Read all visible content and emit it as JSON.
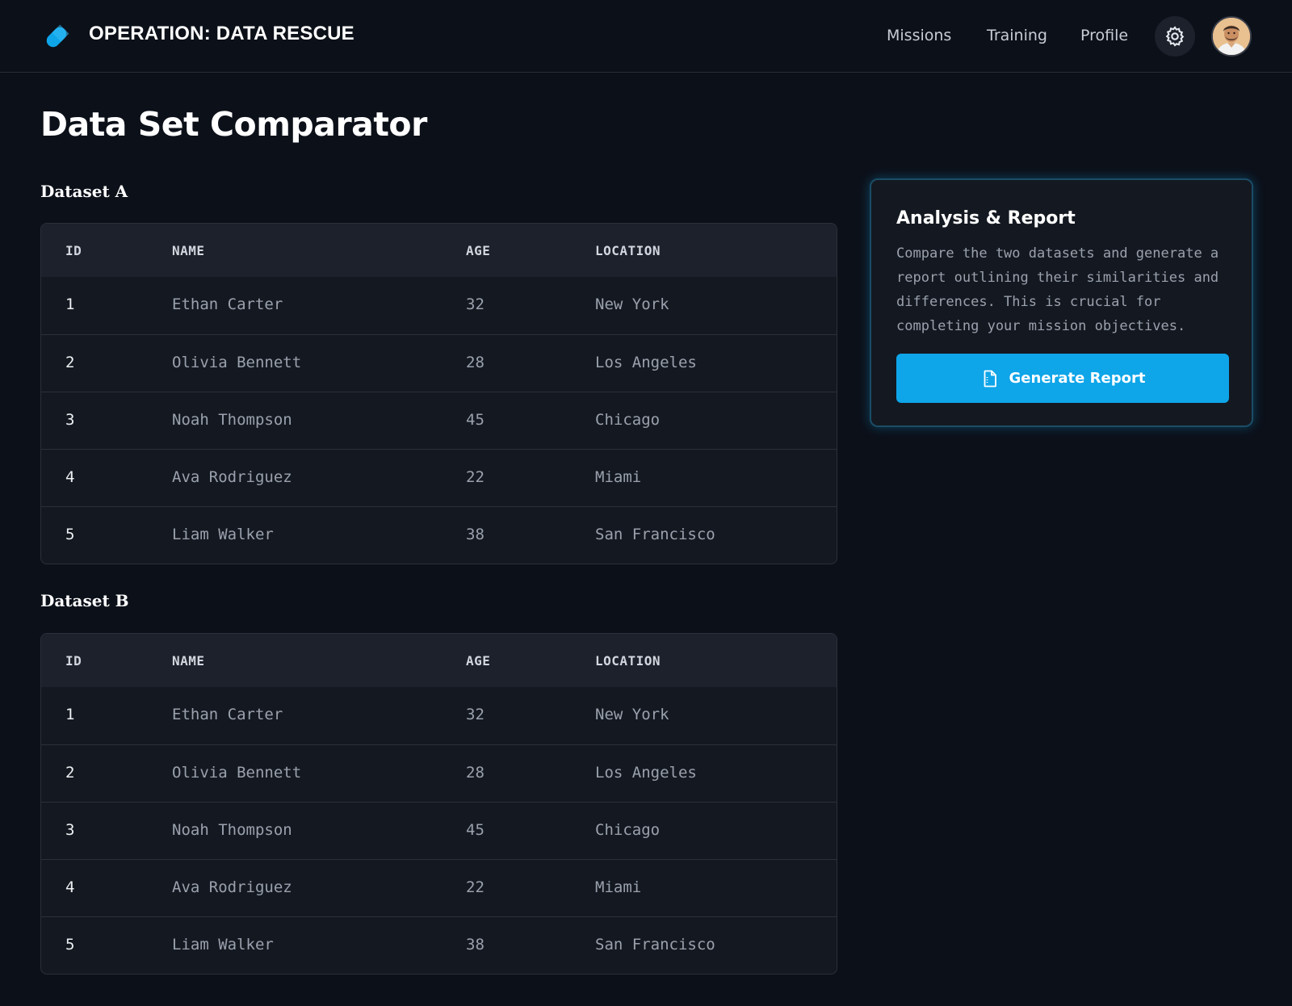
{
  "header": {
    "app_title": "OPERATION: DATA RESCUE",
    "logo_icon": "pill-capsule-icon",
    "nav": [
      {
        "label": "Missions"
      },
      {
        "label": "Training"
      },
      {
        "label": "Profile"
      }
    ],
    "settings_icon": "gear-icon",
    "avatar_icon": "user-avatar"
  },
  "main": {
    "page_title": "Data Set Comparator",
    "datasets": [
      {
        "title": "Dataset A",
        "columns": [
          "ID",
          "NAME",
          "AGE",
          "LOCATION"
        ],
        "rows": [
          {
            "id": "1",
            "name": "Ethan Carter",
            "age": "32",
            "location": "New York"
          },
          {
            "id": "2",
            "name": "Olivia Bennett",
            "age": "28",
            "location": "Los Angeles"
          },
          {
            "id": "3",
            "name": "Noah Thompson",
            "age": "45",
            "location": "Chicago"
          },
          {
            "id": "4",
            "name": "Ava Rodriguez",
            "age": "22",
            "location": "Miami"
          },
          {
            "id": "5",
            "name": "Liam Walker",
            "age": "38",
            "location": "San Francisco"
          }
        ]
      },
      {
        "title": "Dataset B",
        "columns": [
          "ID",
          "NAME",
          "AGE",
          "LOCATION"
        ],
        "rows": [
          {
            "id": "1",
            "name": "Ethan Carter",
            "age": "32",
            "location": "New York"
          },
          {
            "id": "2",
            "name": "Olivia Bennett",
            "age": "28",
            "location": "Los Angeles"
          },
          {
            "id": "3",
            "name": "Noah Thompson",
            "age": "45",
            "location": "Chicago"
          },
          {
            "id": "4",
            "name": "Ava Rodriguez",
            "age": "22",
            "location": "Miami"
          },
          {
            "id": "5",
            "name": "Liam Walker",
            "age": "38",
            "location": "San Francisco"
          }
        ]
      }
    ]
  },
  "report": {
    "title": "Analysis & Report",
    "description": "Compare the two datasets and generate a report outlining their similarities and differences. This is crucial for completing your mission objectives.",
    "button_label": "Generate Report",
    "button_icon": "document-icon"
  },
  "colors": {
    "background": "#0c1019",
    "accent": "#0ea5e9",
    "card": "#141921"
  }
}
